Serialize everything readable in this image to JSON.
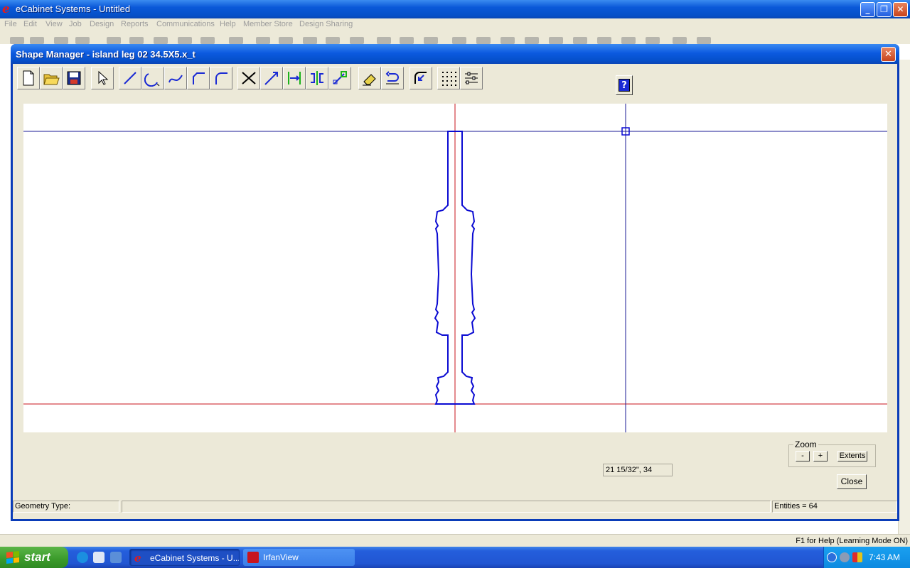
{
  "app": {
    "title": "eCabinet Systems - Untitled"
  },
  "menu": [
    "File",
    "Edit",
    "View",
    "Job",
    "Design",
    "Reports",
    "Communications",
    "Help",
    "Member Store",
    "Design Sharing"
  ],
  "dialog": {
    "title": "Shape Manager - island leg 02 34.5X5.x_t",
    "help_glyph": "?",
    "close_glyph": "✕",
    "zoom": {
      "label": "Zoom",
      "minus": "-",
      "plus": "+",
      "extents": "Extents"
    },
    "coord_readout": "21 15/32\", 34",
    "close_button": "Close",
    "status": {
      "geometry_type": "Geometry Type:",
      "entities": "Entities = 64"
    }
  },
  "toolbar_icons": [
    "new-icon",
    "open-icon",
    "save-icon",
    "select-arrow-icon",
    "line-icon",
    "arc-icon",
    "spline-icon",
    "fillet-icon",
    "round-corner-icon",
    "trim-icon",
    "extend-icon",
    "dimension-icon",
    "mirror-icon",
    "move-icon",
    "eraser-icon",
    "undo-icon",
    "offset-icon",
    "grid-icon",
    "settings-icon"
  ],
  "colors": {
    "shape_line": "#0a0ad2",
    "axis_red": "#c8141e",
    "axis_blue": "#1a1a96",
    "title_bar": "#0a58d8"
  },
  "app_status": "F1 for Help (Learning Mode ON)",
  "taskbar": {
    "start": "start",
    "tasks": [
      "eCabinet Systems - U...",
      "IrfanView"
    ],
    "clock": "7:43 AM"
  }
}
